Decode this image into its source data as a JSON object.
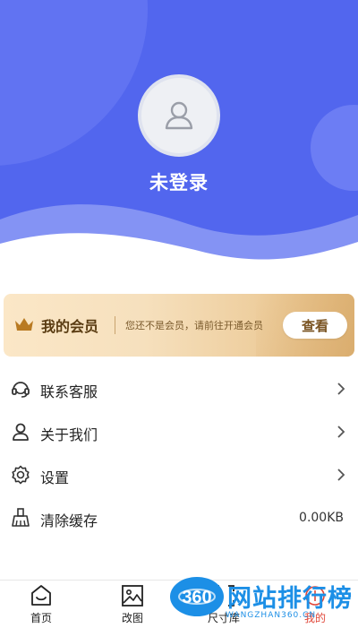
{
  "header": {
    "login_status": "未登录",
    "bg_color": "#5266ee"
  },
  "vip": {
    "title": "我的会员",
    "description": "您还不是会员，请前往开通会员",
    "button_label": "查看",
    "icon": "crown-icon"
  },
  "menu": {
    "items": [
      {
        "label": "联系客服",
        "icon": "headset-icon"
      },
      {
        "label": "关于我们",
        "icon": "person-icon"
      },
      {
        "label": "设置",
        "icon": "gear-icon"
      },
      {
        "label": "清除缓存",
        "icon": "broom-icon",
        "value": "0.00KB"
      }
    ]
  },
  "tabbar": {
    "tabs": [
      {
        "label": "首页",
        "icon": "home-icon"
      },
      {
        "label": "改图",
        "icon": "image-icon"
      },
      {
        "label": "尺寸库",
        "icon": "scan-icon"
      },
      {
        "label": "我的",
        "icon": "user-icon",
        "active": true
      }
    ],
    "active_color": "#e0473a"
  },
  "watermark": {
    "badge": "360",
    "text": "网站排行榜",
    "sub": "WANGZHAN360.CN"
  }
}
